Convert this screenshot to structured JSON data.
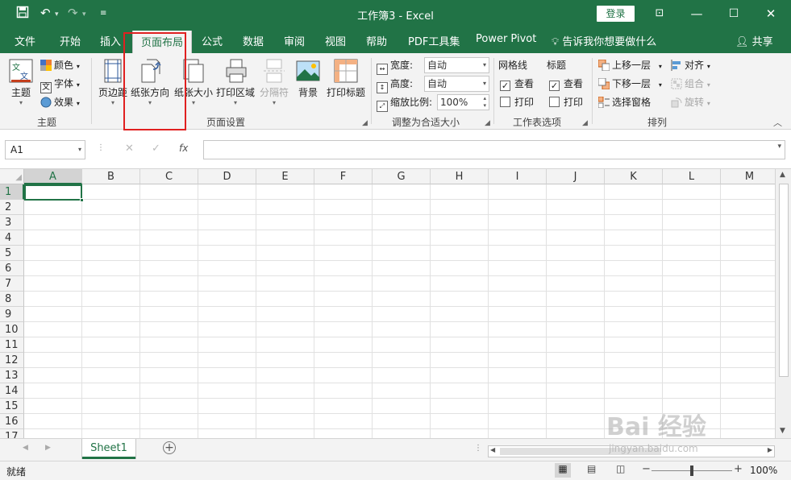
{
  "titlebar": {
    "title": "工作簿3  -  Excel",
    "login": "登录"
  },
  "tabs": [
    "文件",
    "开始",
    "插入",
    "页面布局",
    "公式",
    "数据",
    "审阅",
    "视图",
    "帮助",
    "PDF工具集",
    "Power Pivot"
  ],
  "tell_me": "告诉我你想要做什么",
  "share": "共享",
  "ribbon": {
    "theme_group": {
      "label": "主题",
      "theme_btn": "主题",
      "colors": "颜色",
      "fonts": "字体",
      "effects": "效果"
    },
    "page_setup_group": {
      "label": "页面设置",
      "margins": "页边距",
      "orientation": "纸张方向",
      "size": "纸张大小",
      "print_area": "打印区域",
      "breaks": "分隔符",
      "background": "背景",
      "print_titles": "打印标题"
    },
    "scale_group": {
      "label": "调整为合适大小",
      "width_label": "宽度:",
      "width_value": "自动",
      "height_label": "高度:",
      "height_value": "自动",
      "scale_label": "缩放比例:",
      "scale_value": "100%"
    },
    "sheet_options_group": {
      "label": "工作表选项",
      "gridlines": "网格线",
      "headings": "标题",
      "view": "查看",
      "print": "打印"
    },
    "arrange_group": {
      "label": "排列",
      "bring_forward": "上移一层",
      "send_backward": "下移一层",
      "selection_pane": "选择窗格",
      "align": "对齐",
      "group": "组合",
      "rotate": "旋转"
    }
  },
  "formula_bar": {
    "name_box": "A1",
    "cancel": "✕",
    "enter": "✓",
    "fx": "fx"
  },
  "columns": [
    "A",
    "B",
    "C",
    "D",
    "E",
    "F",
    "G",
    "H",
    "I",
    "J",
    "K",
    "L",
    "M"
  ],
  "rows": [
    "1",
    "2",
    "3",
    "4",
    "5",
    "6",
    "7",
    "8",
    "9",
    "10",
    "11",
    "12",
    "13",
    "14",
    "15",
    "16",
    "17"
  ],
  "sheet_tab": "Sheet1",
  "status": {
    "ready": "就绪",
    "zoom": "100%",
    "zoom_level": 0.5
  },
  "watermark": {
    "main": "Bai 经验",
    "sub": "jingyan.baidu.com"
  },
  "colors": {
    "brand": "#217346",
    "highlight": "#e02020"
  }
}
